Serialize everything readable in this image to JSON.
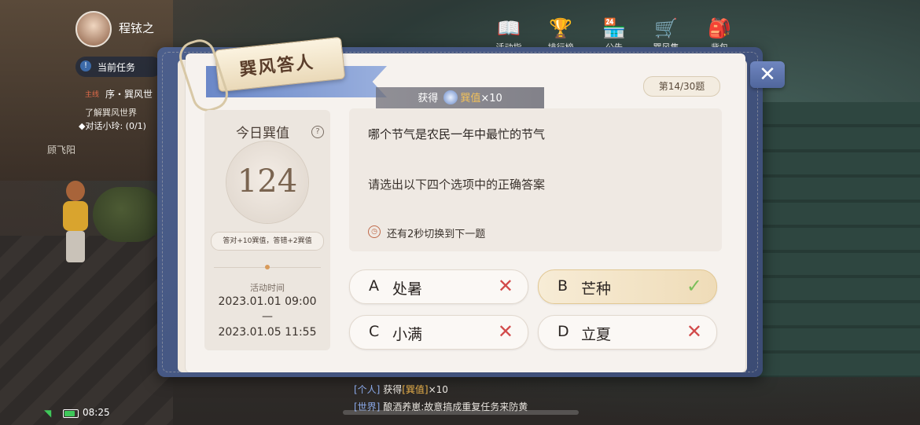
{
  "player": {
    "name": "程铱之"
  },
  "quest": {
    "panel_label": "当前任务",
    "tag": "主线",
    "title": "序・巽风世",
    "description": "了解巽风世界",
    "progress": "◆对话小玲: (0/1)"
  },
  "npc": {
    "name": "顾飞阳"
  },
  "hud": {
    "icons": [
      {
        "icon": "book-icon",
        "label": "活动指引"
      },
      {
        "icon": "trophy-icon",
        "label": "排行榜"
      },
      {
        "icon": "shop-icon",
        "label": "公告"
      },
      {
        "icon": "cart-icon",
        "label": "巽风集市"
      },
      {
        "icon": "bag-icon",
        "label": "背包"
      }
    ]
  },
  "modal": {
    "title": "巽风答人",
    "close_icon": "close-icon",
    "question_counter": "第14/30题",
    "reward": {
      "prefix": "获得",
      "item": "巽值",
      "amount": "×10"
    }
  },
  "stats": {
    "title": "今日巽值",
    "help": "?",
    "score": "124",
    "rule": "答对+10巽值，答错+2巽值",
    "time_label": "活动时间",
    "time_start": "2023.01.01 09:00",
    "time_sep": "—",
    "time_end": "2023.01.05 11:55"
  },
  "question": {
    "text": "哪个节气是农民一年中最忙的节气",
    "instruction": "请选出以下四个选项中的正确答案",
    "timer": "还有2秒切换到下一题"
  },
  "options": [
    {
      "letter": "A",
      "label": "处暑",
      "result": "wrong"
    },
    {
      "letter": "B",
      "label": "芒种",
      "result": "correct"
    },
    {
      "letter": "C",
      "label": "小满",
      "result": "wrong"
    },
    {
      "letter": "D",
      "label": "立夏",
      "result": "wrong"
    }
  ],
  "chat": [
    {
      "tag": "[个人]",
      "text": " 获得",
      "item": "[巽值]",
      "suffix": "×10"
    },
    {
      "tag": "[世界]",
      "text": " 酿酒养崽:故意搞成重复任务来防黄",
      "item": "",
      "suffix": ""
    }
  ],
  "status": {
    "time": "08:25",
    "battery_level": 0.8
  },
  "colors": {
    "accent_blue": "#4c5f8c",
    "wrong": "#d24a4a",
    "correct": "#7cbf5a",
    "gold": "#e8b04a"
  }
}
